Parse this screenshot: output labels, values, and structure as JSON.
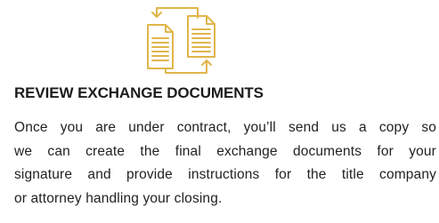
{
  "icon": {
    "name": "document-exchange-icon",
    "color": "#E0B64A"
  },
  "heading": "REVIEW EXCHANGE DOCUMENTS",
  "body_lines": [
    "Once you are under contract, you’ll send us a copy so",
    "we can create the final exchange documents for your",
    "signature and provide instructions for the title company",
    "or attorney handling your closing."
  ]
}
